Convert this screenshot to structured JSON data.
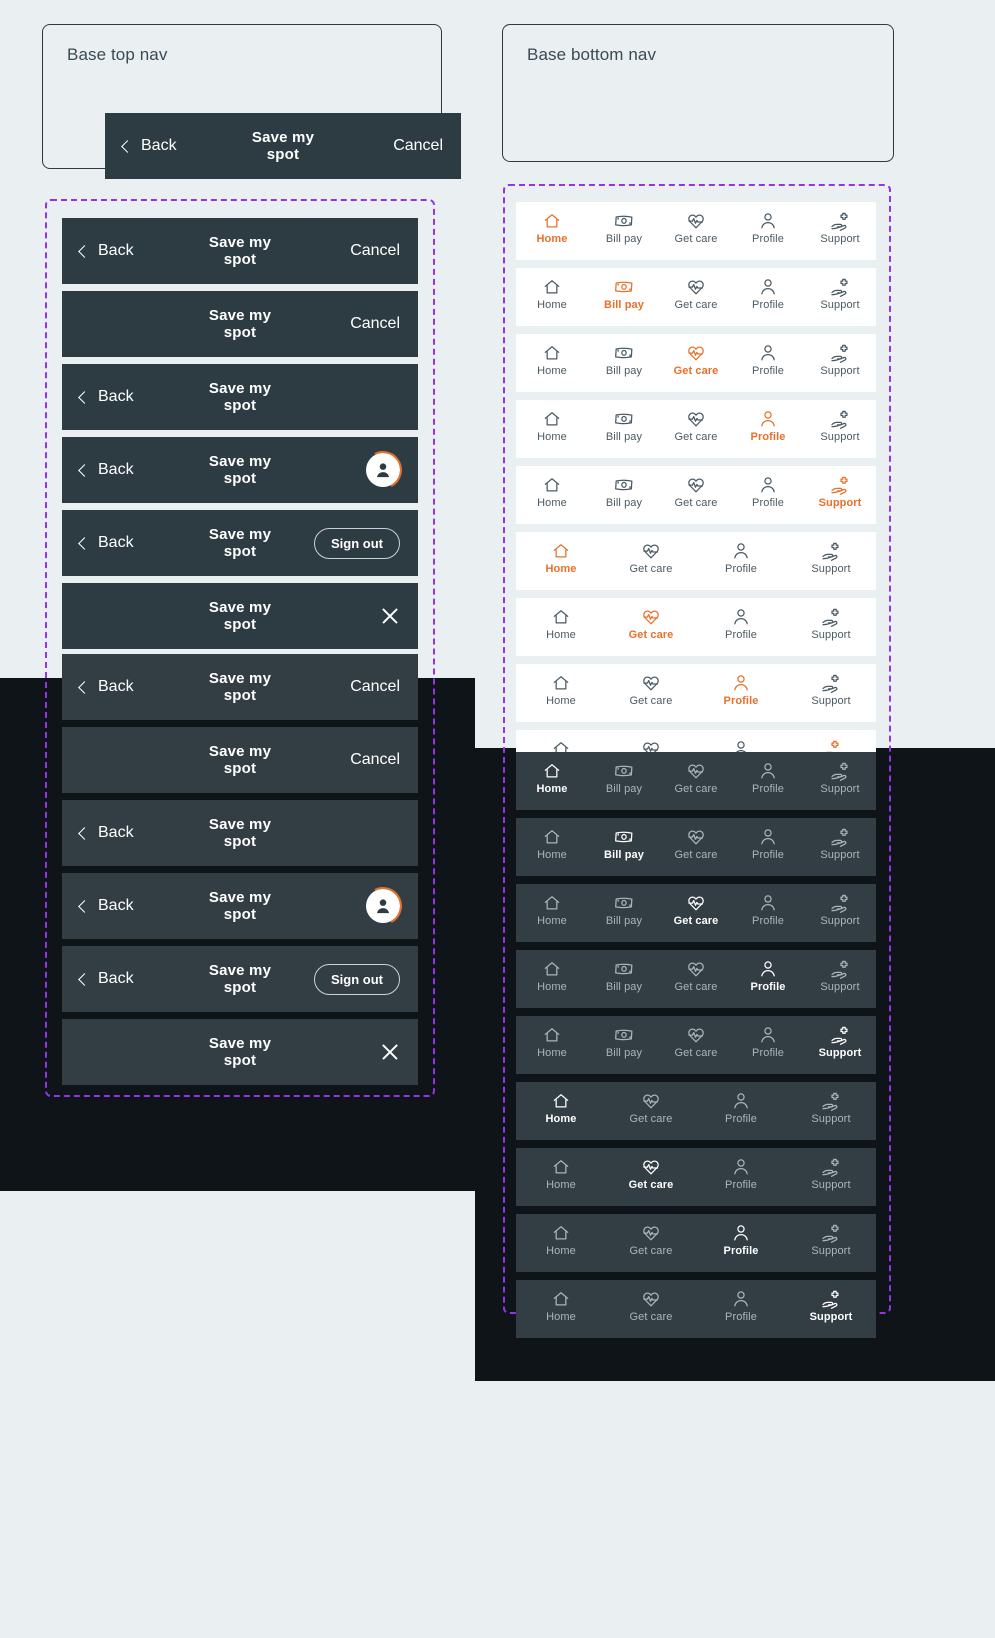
{
  "cards": {
    "top_nav_title": "Base top nav",
    "bottom_nav_title": "Base bottom nav"
  },
  "labels": {
    "back": "Back",
    "cancel": "Cancel",
    "title": "Save my spot",
    "sign_out": "Sign out"
  },
  "icons": {
    "chevron_left": "chevron-left-icon",
    "close": "close-icon",
    "avatar": "avatar-icon",
    "home": "home-icon",
    "bill_pay": "bill-pay-icon",
    "get_care": "get-care-icon",
    "profile": "profile-icon",
    "support": "support-icon"
  },
  "colors": {
    "accent_orange": "#e8702a",
    "nav_dark": "#2d3b43",
    "nav_dark_mode": "#333d44",
    "page_bg": "#eaf0f2",
    "overlay_dark": "#0f1418",
    "spec_dashed": "#9333ea",
    "text_muted": "#4a5a64",
    "text_muted_dark": "#aab4bb"
  },
  "nav_tabs": {
    "home": "Home",
    "bill_pay": "Bill pay",
    "get_care": "Get care",
    "profile": "Profile",
    "support": "Support"
  },
  "top_nav_variants": [
    {
      "id": "back-title-cancel",
      "back": true,
      "title": "Save my spot",
      "right": "cancel"
    },
    {
      "id": "title-cancel",
      "back": false,
      "title": "Save my spot",
      "right": "cancel"
    },
    {
      "id": "back-title",
      "back": true,
      "title": "Save my spot",
      "right": "none"
    },
    {
      "id": "back-title-avatar",
      "back": true,
      "title": "Save my spot",
      "right": "avatar"
    },
    {
      "id": "back-title-signout",
      "back": true,
      "title": "Save my spot",
      "right": "signout"
    },
    {
      "id": "title-close",
      "back": false,
      "title": "Save my spot",
      "right": "close"
    }
  ],
  "bottom_nav_variants": [
    {
      "id": "five-home",
      "items": [
        "home",
        "bill_pay",
        "get_care",
        "profile",
        "support"
      ],
      "active": "home"
    },
    {
      "id": "five-bill-pay",
      "items": [
        "home",
        "bill_pay",
        "get_care",
        "profile",
        "support"
      ],
      "active": "bill_pay"
    },
    {
      "id": "five-get-care",
      "items": [
        "home",
        "bill_pay",
        "get_care",
        "profile",
        "support"
      ],
      "active": "get_care"
    },
    {
      "id": "five-profile",
      "items": [
        "home",
        "bill_pay",
        "get_care",
        "profile",
        "support"
      ],
      "active": "profile"
    },
    {
      "id": "five-support",
      "items": [
        "home",
        "bill_pay",
        "get_care",
        "profile",
        "support"
      ],
      "active": "support"
    },
    {
      "id": "four-home",
      "items": [
        "home",
        "get_care",
        "profile",
        "support"
      ],
      "active": "home"
    },
    {
      "id": "four-get-care",
      "items": [
        "home",
        "get_care",
        "profile",
        "support"
      ],
      "active": "get_care"
    },
    {
      "id": "four-profile",
      "items": [
        "home",
        "get_care",
        "profile",
        "support"
      ],
      "active": "profile"
    },
    {
      "id": "four-support",
      "items": [
        "home",
        "get_care",
        "profile",
        "support"
      ],
      "active": "support"
    }
  ]
}
